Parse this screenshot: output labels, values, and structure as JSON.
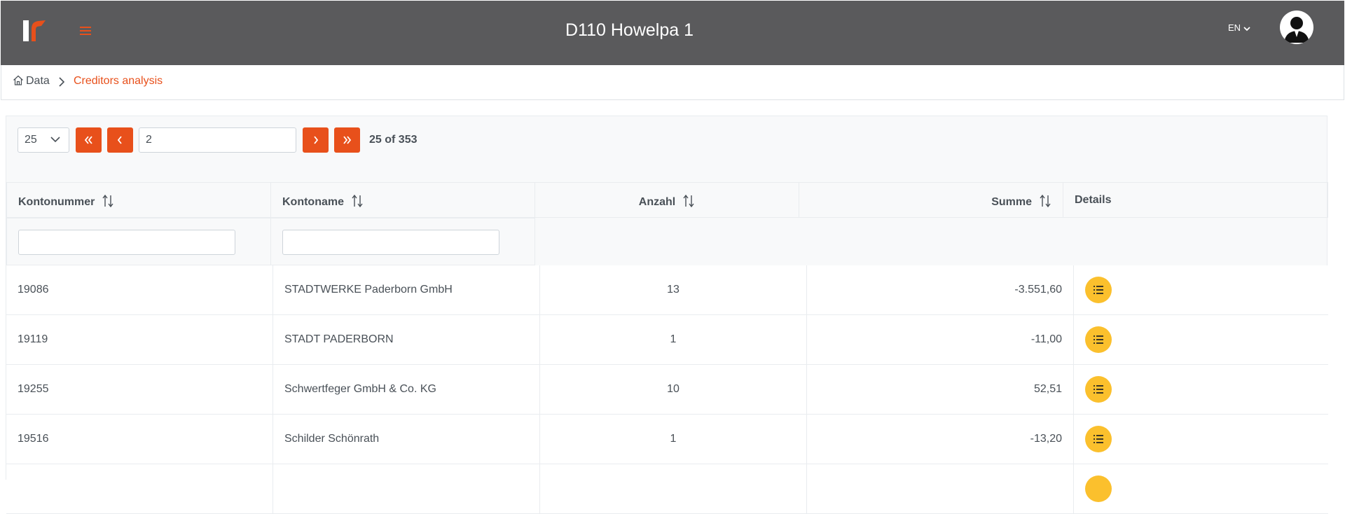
{
  "header": {
    "title": "D110 Howelpa 1",
    "language": "EN",
    "accent_color": "#e8501b",
    "bar_color": "#5a5a5c"
  },
  "breadcrumb": {
    "home_label": "Data",
    "current_label": "Creditors analysis"
  },
  "paginator": {
    "rows_per_page": "25",
    "current_page": "2",
    "count_text": "25 of 353"
  },
  "table": {
    "columns": [
      {
        "label": "Kontonummer",
        "sortable": true
      },
      {
        "label": "Kontoname",
        "sortable": true
      },
      {
        "label": "Anzahl",
        "sortable": true
      },
      {
        "label": "Summe",
        "sortable": true
      },
      {
        "label": "Details",
        "sortable": false
      }
    ],
    "filters": {
      "kontonummer": "",
      "kontoname": ""
    },
    "rows": [
      {
        "kontonummer": "19086",
        "kontoname": "STADTWERKE Paderborn GmbH",
        "anzahl": "13",
        "summe": "-3.551,60"
      },
      {
        "kontonummer": "19119",
        "kontoname": "STADT PADERBORN",
        "anzahl": "1",
        "summe": "-11,00"
      },
      {
        "kontonummer": "19255",
        "kontoname": "Schwertfeger GmbH & Co. KG",
        "anzahl": "10",
        "summe": "52,51"
      },
      {
        "kontonummer": "19516",
        "kontoname": "Schilder Schönrath",
        "anzahl": "1",
        "summe": "-13,20"
      }
    ],
    "details_button_color": "#fbc02d"
  }
}
